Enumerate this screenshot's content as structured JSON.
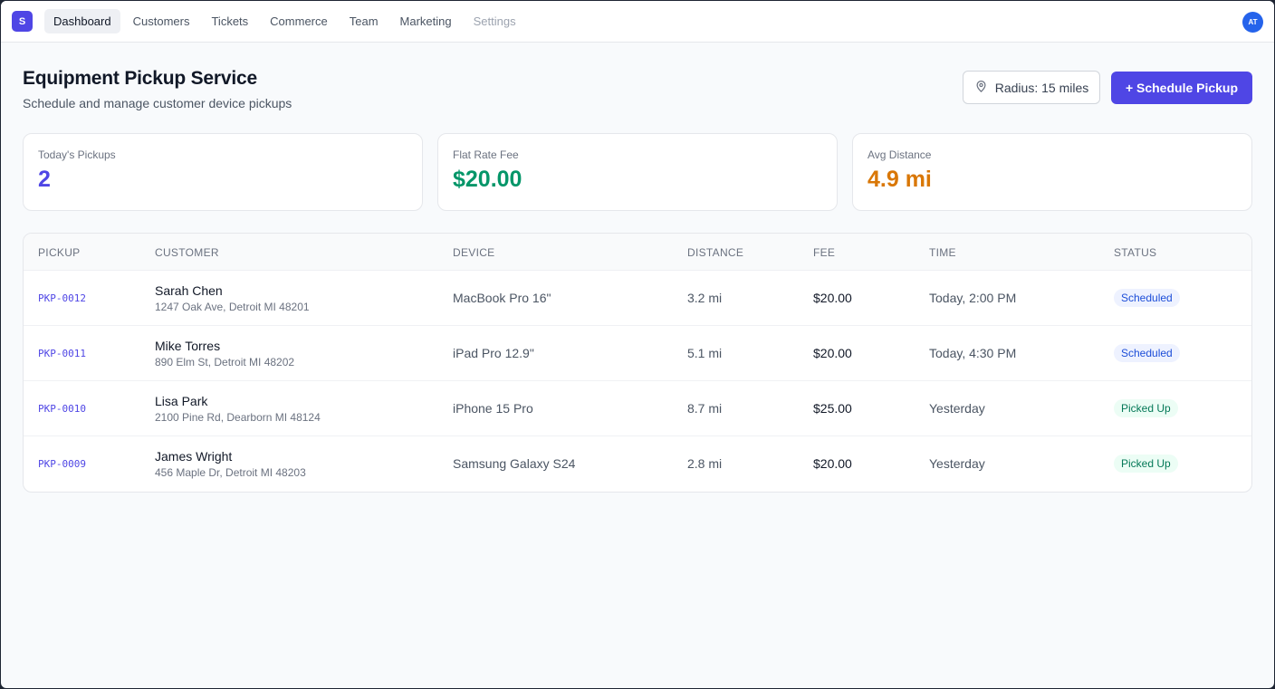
{
  "nav": {
    "logo_letter": "S",
    "items": [
      {
        "label": "Dashboard"
      },
      {
        "label": "Customers"
      },
      {
        "label": "Tickets"
      },
      {
        "label": "Commerce"
      },
      {
        "label": "Team"
      },
      {
        "label": "Marketing"
      },
      {
        "label": "Settings"
      }
    ],
    "active": "Dashboard",
    "avatar_initials": "AT"
  },
  "header": {
    "title": "Equipment Pickup Service",
    "subtitle": "Schedule and manage customer device pickups",
    "radius_label": "Radius: 15 miles",
    "primary_button": "+ Schedule Pickup"
  },
  "stats": [
    {
      "label": "Today's Pickups",
      "value": "2",
      "color": "#4f46e5"
    },
    {
      "label": "Flat Rate Fee",
      "value": "$20.00",
      "color": "#059669"
    },
    {
      "label": "Avg Distance",
      "value": "4.9 mi",
      "color": "#d97706"
    }
  ],
  "table": {
    "headers": [
      "PICKUP",
      "CUSTOMER",
      "DEVICE",
      "DISTANCE",
      "FEE",
      "TIME",
      "STATUS"
    ],
    "rows": [
      {
        "id": "PKP-0012",
        "name": "Sarah Chen",
        "address": "1247 Oak Ave, Detroit MI 48201",
        "device": "MacBook Pro 16\"",
        "distance": "3.2 mi",
        "fee": "$20.00",
        "time": "Today, 2:00 PM",
        "status": "Scheduled"
      },
      {
        "id": "PKP-0011",
        "name": "Mike Torres",
        "address": "890 Elm St, Detroit MI 48202",
        "device": "iPad Pro 12.9\"",
        "distance": "5.1 mi",
        "fee": "$20.00",
        "time": "Today, 4:30 PM",
        "status": "Scheduled"
      },
      {
        "id": "PKP-0010",
        "name": "Lisa Park",
        "address": "2100 Pine Rd, Dearborn MI 48124",
        "device": "iPhone 15 Pro",
        "distance": "8.7 mi",
        "fee": "$25.00",
        "time": "Yesterday",
        "status": "Picked Up"
      },
      {
        "id": "PKP-0009",
        "name": "James Wright",
        "address": "456 Maple Dr, Detroit MI 48203",
        "device": "Samsung Galaxy S24",
        "distance": "2.8 mi",
        "fee": "$20.00",
        "time": "Yesterday",
        "status": "Picked Up"
      }
    ]
  },
  "colors": {
    "accent": "#4f46e5",
    "scheduled_badge": "#1d4ed8",
    "picked_badge": "#047857"
  },
  "icons": {
    "radius": "map-pin-icon"
  }
}
